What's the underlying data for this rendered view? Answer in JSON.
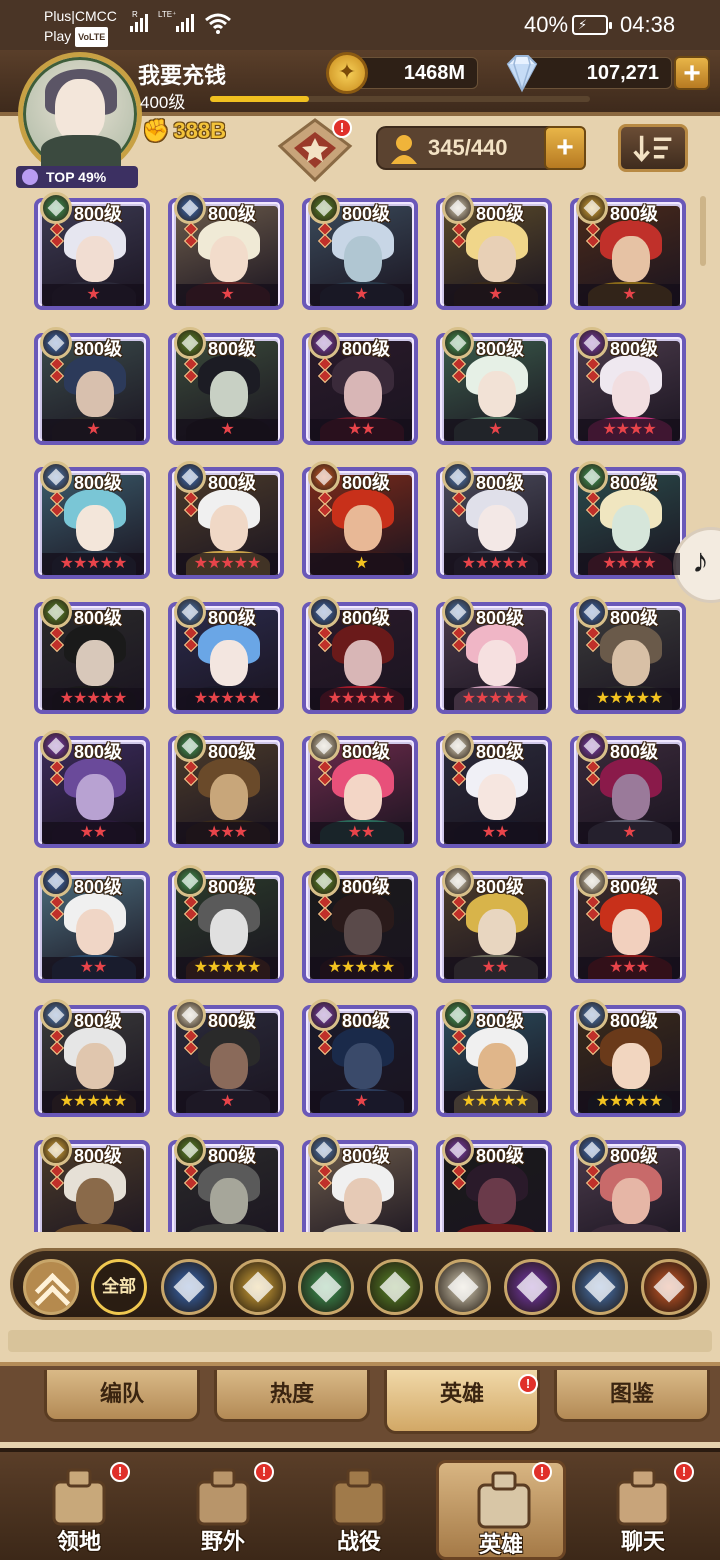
{
  "status_bar": {
    "carrier_top": "Plus|CMCC",
    "carrier_bottom": "Play",
    "volte": "VoLTE",
    "signal1_label": "R",
    "signal2_label": "LTE⁺",
    "battery_percent": "40%",
    "time": "04:38"
  },
  "player": {
    "name": "我要充钱",
    "level": "400级",
    "xp_fraction": 0.26,
    "power": "388B",
    "rank_badge": "TOP 49%"
  },
  "resources": {
    "gold": "1468M",
    "gems": "107,271",
    "add_label": "+"
  },
  "toolbar": {
    "hero_count": "345/440",
    "add_label": "+",
    "emblem_alert": "!"
  },
  "faction_colors": {
    "lightbearer": "#d9a93a",
    "mauler": "#d05a2a",
    "wilder": "#3e9a58",
    "graveborn": "#5a8a2a",
    "celestial": "#d8cfb8",
    "hypogean": "#7a3ab2",
    "dimensional": "#4a78b8",
    "tide": "#3a6ab8"
  },
  "heroes": [
    {
      "level": "800级",
      "faction": "wilder",
      "stars": "★",
      "star_color": "red",
      "hair": "#e6e6f0",
      "skin": "#f1ddd2",
      "bg": "#3c3a52",
      "clothes": "#2c2a3a"
    },
    {
      "level": "800级",
      "faction": "tide",
      "stars": "★",
      "star_color": "red",
      "hair": "#f0ead6",
      "skin": "#f2dccb",
      "bg": "#6a5a4a",
      "clothes": "#6a2a2a"
    },
    {
      "level": "800级",
      "faction": "graveborn",
      "stars": "★",
      "star_color": "red",
      "hair": "#c8d6e6",
      "skin": "#b0c6d2",
      "bg": "#3a4a5a",
      "clothes": "#2a3a4a"
    },
    {
      "level": "800级",
      "faction": "celestial",
      "stars": "★",
      "star_color": "red",
      "hair": "#f0d68a",
      "skin": "#e8d0b6",
      "bg": "#5a4a2a",
      "clothes": "#3a2a1a"
    },
    {
      "level": "800级",
      "faction": "lightbearer",
      "stars": "★",
      "star_color": "red",
      "hair": "#c0302a",
      "skin": "#e6c2a4",
      "bg": "#4a2a1a",
      "clothes": "#8a6a1a"
    },
    {
      "level": "800级",
      "faction": "tide",
      "stars": "★",
      "star_color": "red",
      "hair": "#2c3a5a",
      "skin": "#d8c0ae",
      "bg": "#3a4a4a",
      "clothes": "#2a2a2a"
    },
    {
      "level": "800级",
      "faction": "graveborn",
      "stars": "★",
      "star_color": "red",
      "hair": "#1c1c24",
      "skin": "#c8d0c4",
      "bg": "#3a4a3a",
      "clothes": "#1a1a1a"
    },
    {
      "level": "800级",
      "faction": "hypogean",
      "stars": "★★",
      "star_color": "red",
      "hair": "#3a2a3a",
      "skin": "#d8b6b6",
      "bg": "#2a1a2a",
      "clothes": "#6a1a2a"
    },
    {
      "level": "800级",
      "faction": "wilder",
      "stars": "★",
      "star_color": "red",
      "hair": "#e6f0e6",
      "skin": "#f2e2d6",
      "bg": "#3a5a4a",
      "clothes": "#4a6a5a"
    },
    {
      "level": "800级",
      "faction": "hypogean",
      "stars": "★★★★",
      "star_color": "red",
      "hair": "#efe8f0",
      "skin": "#f2dee0",
      "bg": "#4a3a4a",
      "clothes": "#c0307a"
    },
    {
      "level": "800级",
      "faction": "dimensional",
      "stars": "★★★★★",
      "star_color": "red",
      "hair": "#7ac6d6",
      "skin": "#f3e6da",
      "bg": "#3a5a6a",
      "clothes": "#2a3a4a"
    },
    {
      "level": "800级",
      "faction": "tide",
      "stars": "★★★★★",
      "star_color": "red",
      "hair": "#f0f0f0",
      "skin": "#f0d8c6",
      "bg": "#4a3a2a",
      "clothes": "#c8a24a"
    },
    {
      "level": "800级",
      "faction": "mauler",
      "stars": "★",
      "star_color": "gold",
      "hair": "#c8301a",
      "skin": "#e8b896",
      "bg": "#7a2a1a",
      "clothes": "#3a1a1a"
    },
    {
      "level": "800级",
      "faction": "dimensional",
      "stars": "★★★★★",
      "star_color": "red",
      "hair": "#e0e0ea",
      "skin": "#f3e8e6",
      "bg": "#4a4a5a",
      "clothes": "#3a3a4a"
    },
    {
      "level": "800级",
      "faction": "wilder",
      "stars": "★★★★",
      "star_color": "red",
      "hair": "#f0e6c0",
      "skin": "#d6e6da",
      "bg": "#2a4a4a",
      "clothes": "#8a2a3a"
    },
    {
      "level": "800级",
      "faction": "graveborn",
      "stars": "★★★★★",
      "star_color": "red",
      "hair": "#1a1a1a",
      "skin": "#d8c8ba",
      "bg": "#2a2a2a",
      "clothes": "#1a1a1a"
    },
    {
      "level": "800级",
      "faction": "dimensional",
      "stars": "★★★★★",
      "star_color": "red",
      "hair": "#6aa6e6",
      "skin": "#f3e6e0",
      "bg": "#2a2a4a",
      "clothes": "#1a1a2a"
    },
    {
      "level": "800级",
      "faction": "tide",
      "stars": "★★★★★",
      "star_color": "red",
      "hair": "#6a1a1a",
      "skin": "#d8b6b6",
      "bg": "#2a1a2a",
      "clothes": "#a01a2a"
    },
    {
      "level": "800级",
      "faction": "dimensional",
      "stars": "★★★★★",
      "star_color": "red",
      "hair": "#f0b6c6",
      "skin": "#f6e0e0",
      "bg": "#4a3a4a",
      "clothes": "#c89ab6"
    },
    {
      "level": "800级",
      "faction": "tide",
      "stars": "★★★★★",
      "star_color": "gold",
      "hair": "#6a5a4a",
      "skin": "#d8c0a6",
      "bg": "#3a3a3a",
      "clothes": "#2a2a2a"
    },
    {
      "level": "800级",
      "faction": "hypogean",
      "stars": "★★",
      "star_color": "red",
      "hair": "#6a4a9a",
      "skin": "#b8a2d2",
      "bg": "#3a2a5a",
      "clothes": "#2a1a3a"
    },
    {
      "level": "800级",
      "faction": "wilder",
      "stars": "★★★",
      "star_color": "red",
      "hair": "#6a4a2a",
      "skin": "#c8a67a",
      "bg": "#4a3a2a",
      "clothes": "#3a2a1a"
    },
    {
      "level": "800级",
      "faction": "celestial",
      "stars": "★★",
      "star_color": "red",
      "hair": "#e8507a",
      "skin": "#f3d6c6",
      "bg": "#6a2a4a",
      "clothes": "#2a6a5a"
    },
    {
      "level": "800级",
      "faction": "celestial",
      "stars": "★★",
      "star_color": "red",
      "hair": "#f0f0f6",
      "skin": "#f6e6e0",
      "bg": "#2a2a3a",
      "clothes": "#1a1a2a"
    },
    {
      "level": "800级",
      "faction": "hypogean",
      "stars": "★",
      "star_color": "red",
      "hair": "#8a1a4a",
      "skin": "#9a7a9a",
      "bg": "#3a2a3a",
      "clothes": "#5a5a6a"
    },
    {
      "level": "800级",
      "faction": "tide",
      "stars": "★★",
      "star_color": "red",
      "hair": "#f0f0f0",
      "skin": "#f0d6c6",
      "bg": "#4a6a7a",
      "clothes": "#2a4a6a"
    },
    {
      "level": "800级",
      "faction": "wilder",
      "stars": "★★★★★",
      "star_color": "gold",
      "hair": "#5a5a5a",
      "skin": "#e0e0e0",
      "bg": "#2a3a2a",
      "clothes": "#6a3a1a"
    },
    {
      "level": "800级",
      "faction": "graveborn",
      "stars": "★★★★★",
      "star_color": "gold",
      "hair": "#2a1a1a",
      "skin": "#5a4a4a",
      "bg": "#1a1a1a",
      "clothes": "#3a1a1a"
    },
    {
      "level": "800级",
      "faction": "celestial",
      "stars": "★★",
      "star_color": "red",
      "hair": "#d8b44a",
      "skin": "#e8d6c0",
      "bg": "#4a3a2a",
      "clothes": "#6a6a5a"
    },
    {
      "level": "800级",
      "faction": "celestial",
      "stars": "★★★",
      "star_color": "red",
      "hair": "#c8301a",
      "skin": "#f2d0be",
      "bg": "#3a2a2a",
      "clothes": "#8a1a1a"
    },
    {
      "level": "800级",
      "faction": "dimensional",
      "stars": "★★★★★",
      "star_color": "gold",
      "hair": "#e6e6e6",
      "skin": "#e0c6ae",
      "bg": "#3a3a3a",
      "clothes": "#4a3a2a"
    },
    {
      "level": "800级",
      "faction": "celestial",
      "stars": "★",
      "star_color": "red",
      "hair": "#2a2a2a",
      "skin": "#8a6a5a",
      "bg": "#2a2a3a",
      "clothes": "#3a3a4a"
    },
    {
      "level": "800级",
      "faction": "hypogean",
      "stars": "★",
      "star_color": "red",
      "hair": "#1a2a4a",
      "skin": "#3a4a6a",
      "bg": "#1a1a2a",
      "clothes": "#2a3a5a"
    },
    {
      "level": "800级",
      "faction": "wilder",
      "stars": "★★★★★",
      "star_color": "gold",
      "hair": "#f0f0f0",
      "skin": "#e0b68a",
      "bg": "#2a4a5a",
      "clothes": "#c8b67a"
    },
    {
      "level": "800级",
      "faction": "dimensional",
      "stars": "★★★★★",
      "star_color": "gold",
      "hair": "#6a3a1a",
      "skin": "#f2d6c0",
      "bg": "#3a2a1a",
      "clothes": "#1a2a2a"
    },
    {
      "level": "800级",
      "faction": "lightbearer",
      "stars": "",
      "star_color": "red",
      "hair": "#e6e0d6",
      "skin": "#8a6a4a",
      "bg": "#4a3a2a",
      "clothes": "#6a4a2a"
    },
    {
      "level": "800级",
      "faction": "graveborn",
      "stars": "",
      "star_color": "red",
      "hair": "#5a5a5a",
      "skin": "#a6a69a",
      "bg": "#2a2a2a",
      "clothes": "#3a3a3a"
    },
    {
      "level": "800级",
      "faction": "dimensional",
      "stars": "",
      "star_color": "red",
      "hair": "#f0f0f0",
      "skin": "#e6cab6",
      "bg": "#6a5a4a",
      "clothes": "#d0c6b6"
    },
    {
      "level": "800级",
      "faction": "hypogean",
      "stars": "",
      "star_color": "red",
      "hair": "#2a1a2a",
      "skin": "#6a3a4a",
      "bg": "#1a1a1a",
      "clothes": "#6a1a1a"
    },
    {
      "level": "800级",
      "faction": "tide",
      "stars": "",
      "star_color": "red",
      "hair": "#c86a6a",
      "skin": "#e6b6a6",
      "bg": "#4a3a4a",
      "clothes": "#3a2a3a"
    }
  ],
  "filters": {
    "collapse_icon": "chevron-up-icon",
    "all_label": "全部",
    "items": [
      "tide",
      "lightbearer",
      "wilder",
      "graveborn",
      "celestial",
      "hypogean",
      "dimensional",
      "mauler"
    ]
  },
  "subtabs": [
    {
      "label": "编队"
    },
    {
      "label": "热度"
    },
    {
      "label": "英雄",
      "active": true,
      "alert": "!"
    },
    {
      "label": "图鉴"
    }
  ],
  "bottom_nav": [
    {
      "label": "领地",
      "alert": "!"
    },
    {
      "label": "野外",
      "alert": "!"
    },
    {
      "label": "战役"
    },
    {
      "label": "英雄",
      "alert": "!",
      "active": true
    },
    {
      "label": "聊天",
      "alert": "!"
    }
  ]
}
